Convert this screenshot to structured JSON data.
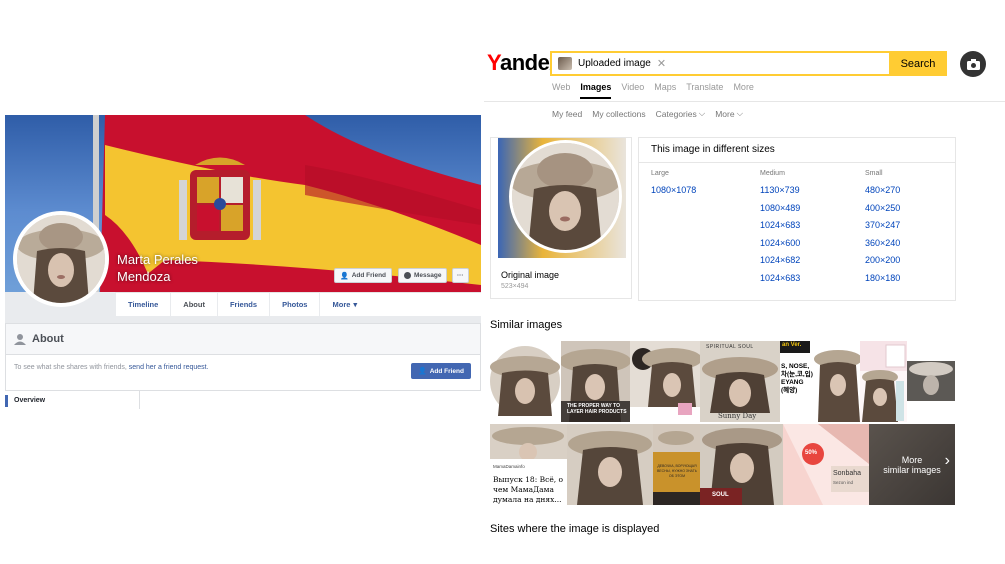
{
  "facebook": {
    "name_line1": "Marta Perales",
    "name_line2": "Mendoza",
    "add_friend_label": "Add Friend",
    "message_label": "Message",
    "more_dots": "···",
    "tabs": [
      "Timeline",
      "About",
      "Friends",
      "Photos",
      "More"
    ],
    "more_caret": "▾",
    "about_title": "About",
    "prompt_prefix": "To see what she shares with friends, ",
    "prompt_link": "send her a friend request.",
    "add_friend_button": "Add Friend",
    "overview_label": "Overview",
    "colors": {
      "brand": "#4267b2",
      "link": "#365899",
      "background": "#e9ebee"
    }
  },
  "yandex": {
    "logo_first": "Y",
    "logo_rest": "andex",
    "search_chip": "Uploaded image",
    "clear_icon": "✕",
    "search_button": "Search",
    "nav": [
      "Web",
      "Images",
      "Video",
      "Maps",
      "Translate",
      "More"
    ],
    "active_nav": "Images",
    "subnav": [
      "My feed",
      "My collections",
      "Categories",
      "More"
    ],
    "caret": "⌵",
    "original_label": "Original image",
    "original_size": "523×494",
    "sizes_title": "This image in different sizes",
    "large_header": "Large",
    "large_sizes": [
      "1080×1078"
    ],
    "medium_header": "Medium",
    "medium_sizes": [
      "1130×739",
      "1080×489",
      "1024×683",
      "1024×600",
      "1024×682",
      "1024×683"
    ],
    "small_header": "Small",
    "small_sizes": [
      "480×270",
      "400×250",
      "370×247",
      "360×240",
      "200×200",
      "180×180"
    ],
    "similar_title": "Similar images",
    "tiles": {
      "t3_text": "THE PROPER WAY TO LAYER HAIR PRODUCTS",
      "t5_top": "SPIRITUAL    SOUL",
      "t5_bottom": "Sunny Day",
      "t6_top": "an Ver.",
      "t6_mid": "S, NOSE,\n차(눈,코,입)\nEYANG\n(혜양)",
      "t7_text": "MamaDamainfo",
      "t7_body": "Выпуск 18: Всё, о чем МамаДама думала на днях...",
      "t8_text": "ДЕВОЧКА, ВОРУЮЩАЯ ВЕСНЫ, НУЖНО ЗНАТЬ ОБ ЭТОМ",
      "t8_bottom": "SOUL",
      "t9_badge": "50%",
      "t9_sub": "Sonbaha",
      "t9_sub2": "Sezon ind"
    },
    "more_similar_line1": "More",
    "more_similar_line2": "similar images",
    "more_arrow": "›",
    "sites_title": "Sites where the image is displayed",
    "colors": {
      "accent": "#ffcc33",
      "link": "#0044bb",
      "logo_red": "#ff0000"
    }
  }
}
